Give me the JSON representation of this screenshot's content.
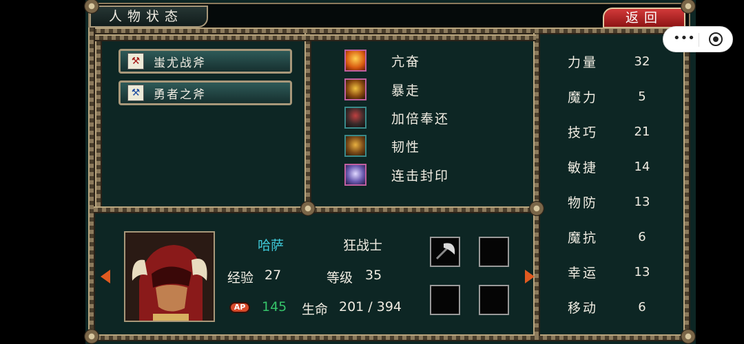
{
  "header": {
    "title": "人物状态",
    "back_label": "返回"
  },
  "equipment": [
    {
      "label": "蚩尤战斧",
      "icon": "red-axe-icon"
    },
    {
      "label": "勇者之斧",
      "icon": "blue-axe-icon"
    }
  ],
  "skills": [
    {
      "label": "亢奋",
      "icon": "fire-warrior-icon"
    },
    {
      "label": "暴走",
      "icon": "berserk-face-icon"
    },
    {
      "label": "加倍奉还",
      "icon": "dark-knight-icon"
    },
    {
      "label": "韧性",
      "icon": "golden-face-icon"
    },
    {
      "label": "连击封印",
      "icon": "purple-warrior-icon"
    }
  ],
  "stats": [
    {
      "label": "力量",
      "value": "32"
    },
    {
      "label": "魔力",
      "value": "5"
    },
    {
      "label": "技巧",
      "value": "21"
    },
    {
      "label": "敏捷",
      "value": "14"
    },
    {
      "label": "物防",
      "value": "13"
    },
    {
      "label": "魔抗",
      "value": "6"
    },
    {
      "label": "幸运",
      "value": "13"
    },
    {
      "label": "移动",
      "value": "6"
    }
  ],
  "character": {
    "name": "哈萨",
    "class": "狂战士",
    "exp_label": "经验",
    "exp_value": "27",
    "level_label": "等级",
    "level_value": "35",
    "ap_badge": "AP",
    "ap_value": "145",
    "hp_label": "生命",
    "hp_value": "201 / 394"
  },
  "colors": {
    "name": "#3ec8d8",
    "ap_value": "#36c46a",
    "back_button": "#c02626"
  }
}
